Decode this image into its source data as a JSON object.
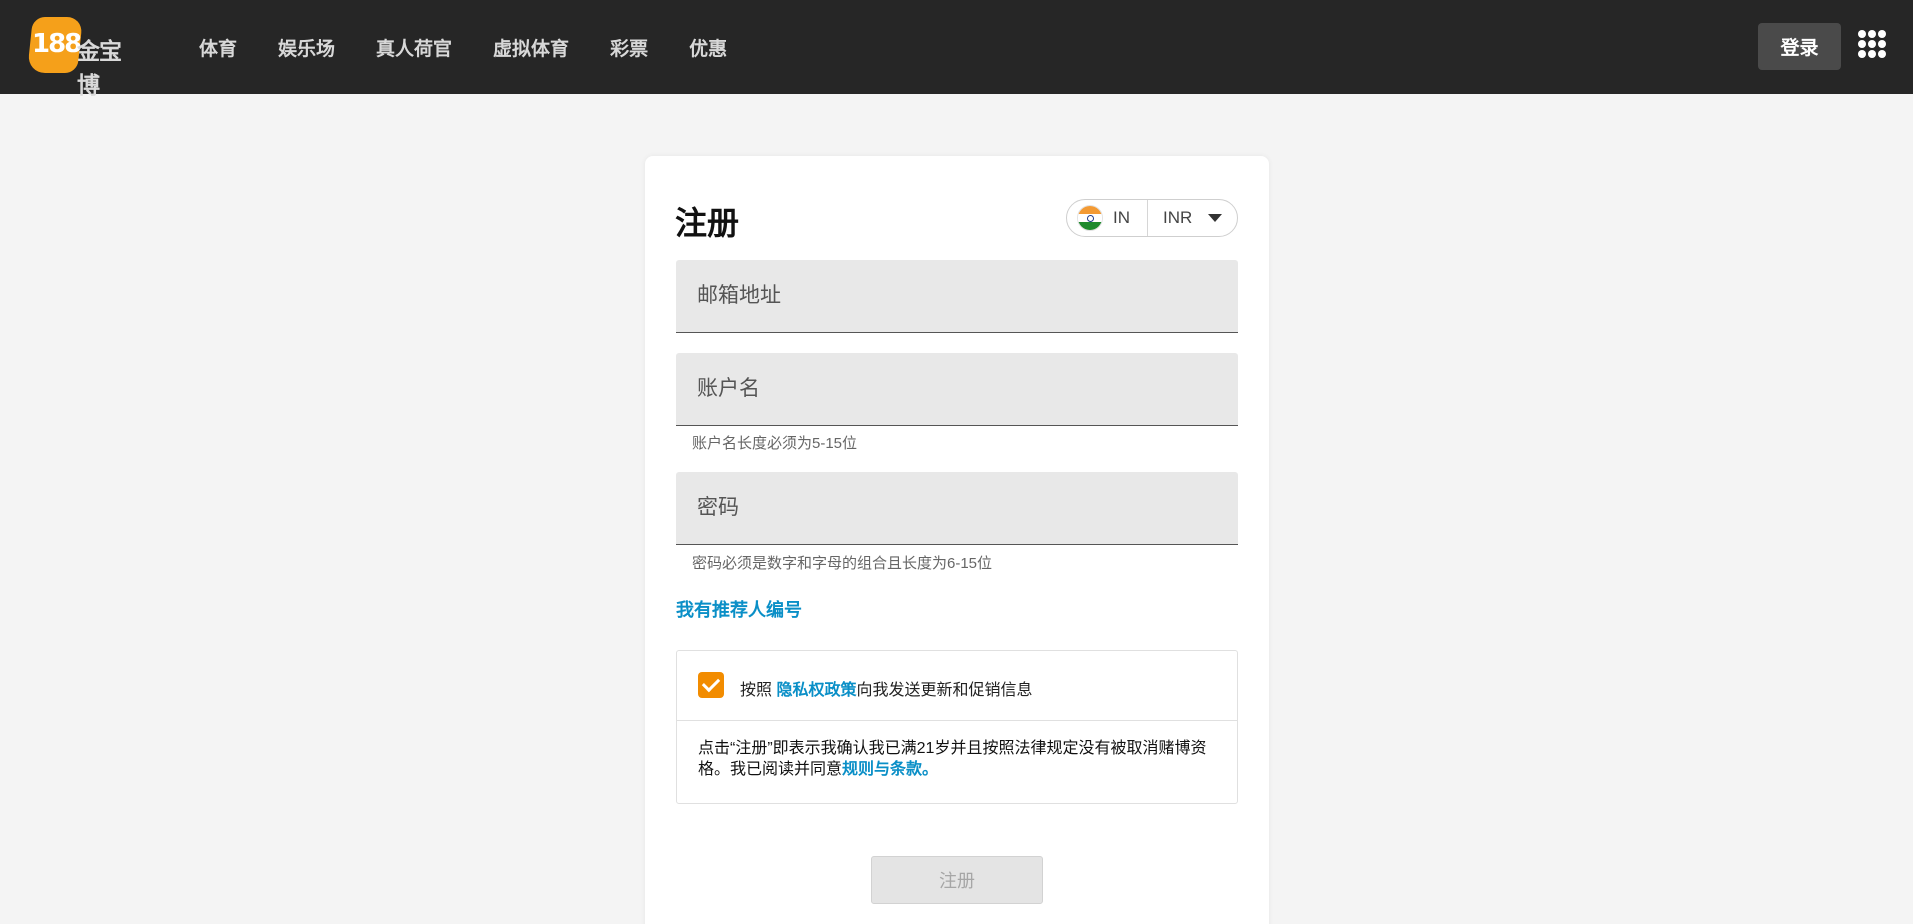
{
  "header": {
    "logo": {
      "number": "188",
      "text": "金宝博"
    },
    "nav": [
      {
        "label": "体育"
      },
      {
        "label": "娱乐场"
      },
      {
        "label": "真人荷官"
      },
      {
        "label": "虚拟体育"
      },
      {
        "label": "彩票"
      },
      {
        "label": "优惠"
      }
    ],
    "login_label": "登录",
    "apps_icon": "grid-dots-icon"
  },
  "form": {
    "title": "注册",
    "region": {
      "country_code": "IN",
      "flag_icon": "india-flag-icon",
      "currency": "INR"
    },
    "email": {
      "placeholder": "邮箱地址",
      "value": ""
    },
    "username": {
      "placeholder": "账户名",
      "value": "",
      "hint": "账户名长度必须为5-15位"
    },
    "password": {
      "placeholder": "密码",
      "value": "",
      "hint": "密码必须是数字和字母的组合且长度为6-15位"
    },
    "referral_link": "我有推荐人编号",
    "consent": {
      "checked": true,
      "prefix": "按照 ",
      "policy_link": "隐私权政策",
      "suffix": "向我发送更新和促销信息"
    },
    "terms": {
      "text": "点击“注册”即表示我确认我已满21岁并且按照法律规定没有被取消赌博资格。我已阅读并同意",
      "link": "规则与条款。"
    },
    "submit_label": "注册"
  },
  "colors": {
    "header_bg": "#262626",
    "accent_orange": "#f28c00",
    "link_blue": "#0a8fc7",
    "page_bg": "#f4f4f4"
  }
}
